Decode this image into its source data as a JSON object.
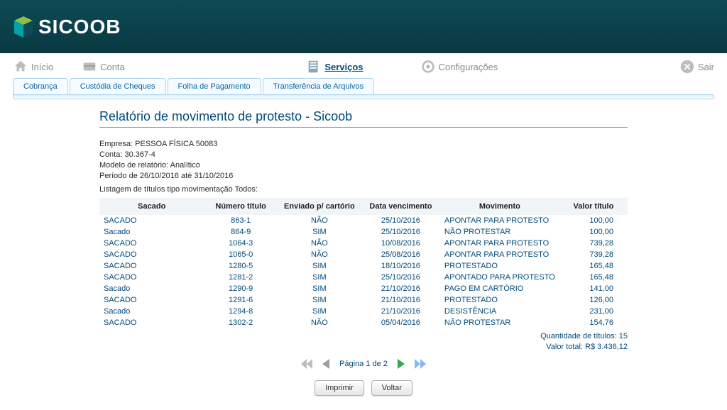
{
  "brand": {
    "name": "SICOOB"
  },
  "nav": {
    "inicio": "Início",
    "conta": "Conta",
    "servicos": "Serviços",
    "configuracoes": "Configurações",
    "sair": "Sair"
  },
  "tabs": {
    "cobranca": "Cobrança",
    "custodia": "Custódia de Cheques",
    "folha": "Folha de Pagamento",
    "transf": "Transferência de Arquivos"
  },
  "report": {
    "title": "Relatório de movimento de protesto - Sicoob",
    "meta": {
      "empresa": "Empresa: PESSOA FÍSICA 50083",
      "conta": "Conta: 30.367-4",
      "modelo": "Modelo de relatório: Analítico",
      "periodo": "Período de 26/10/2016 até 31/10/2016"
    },
    "listagem": "Listagem de títulos tipo movimentação Todos:",
    "columns": {
      "sacado": "Sacado",
      "numero": "Número título",
      "enviado": "Enviado p/ cartório",
      "vencimento": "Data vencimento",
      "movimento": "Movimento",
      "valor": "Valor título"
    },
    "rows": [
      {
        "sacado": "SACADO",
        "numero": "863-1",
        "enviado": "NÃO",
        "vencimento": "25/10/2016",
        "movimento": "APONTAR PARA PROTESTO",
        "valor": "100,00"
      },
      {
        "sacado": "Sacado",
        "numero": "864-9",
        "enviado": "SIM",
        "vencimento": "25/10/2016",
        "movimento": "NÃO PROTESTAR",
        "valor": "100,00"
      },
      {
        "sacado": "SACADO",
        "numero": "1064-3",
        "enviado": "NÃO",
        "vencimento": "10/08/2016",
        "movimento": "APONTAR PARA PROTESTO",
        "valor": "739,28"
      },
      {
        "sacado": "SACADO",
        "numero": "1065-0",
        "enviado": "NÃO",
        "vencimento": "25/08/2016",
        "movimento": "APONTAR PARA PROTESTO",
        "valor": "739,28"
      },
      {
        "sacado": "SACADO",
        "numero": "1280-5",
        "enviado": "SIM",
        "vencimento": "18/10/2016",
        "movimento": "PROTESTADO",
        "valor": "165,48"
      },
      {
        "sacado": "SACADO",
        "numero": "1281-2",
        "enviado": "SIM",
        "vencimento": "25/10/2016",
        "movimento": "APONTADO PARA PROTESTO",
        "valor": "165,48"
      },
      {
        "sacado": "Sacado",
        "numero": "1290-9",
        "enviado": "SIM",
        "vencimento": "21/10/2016",
        "movimento": "PAGO EM CARTÓRIO",
        "valor": "141,00"
      },
      {
        "sacado": "SACADO",
        "numero": "1291-6",
        "enviado": "SIM",
        "vencimento": "21/10/2016",
        "movimento": "PROTESTADO",
        "valor": "126,00"
      },
      {
        "sacado": "Sacado",
        "numero": "1294-8",
        "enviado": "SIM",
        "vencimento": "21/10/2016",
        "movimento": "DESISTÊNCIA",
        "valor": "231,00"
      },
      {
        "sacado": "SACADO",
        "numero": "1302-2",
        "enviado": "NÃO",
        "vencimento": "05/04/2016",
        "movimento": "NÃO PROTESTAR",
        "valor": "154,76"
      }
    ],
    "summary": {
      "quantidade": "Quantidade de títulos: 15",
      "valorTotal": "Valor total: R$ 3.436,12"
    }
  },
  "pager": {
    "label": "Página 1 de 2"
  },
  "buttons": {
    "imprimir": "Imprimir",
    "voltar": "Voltar"
  }
}
